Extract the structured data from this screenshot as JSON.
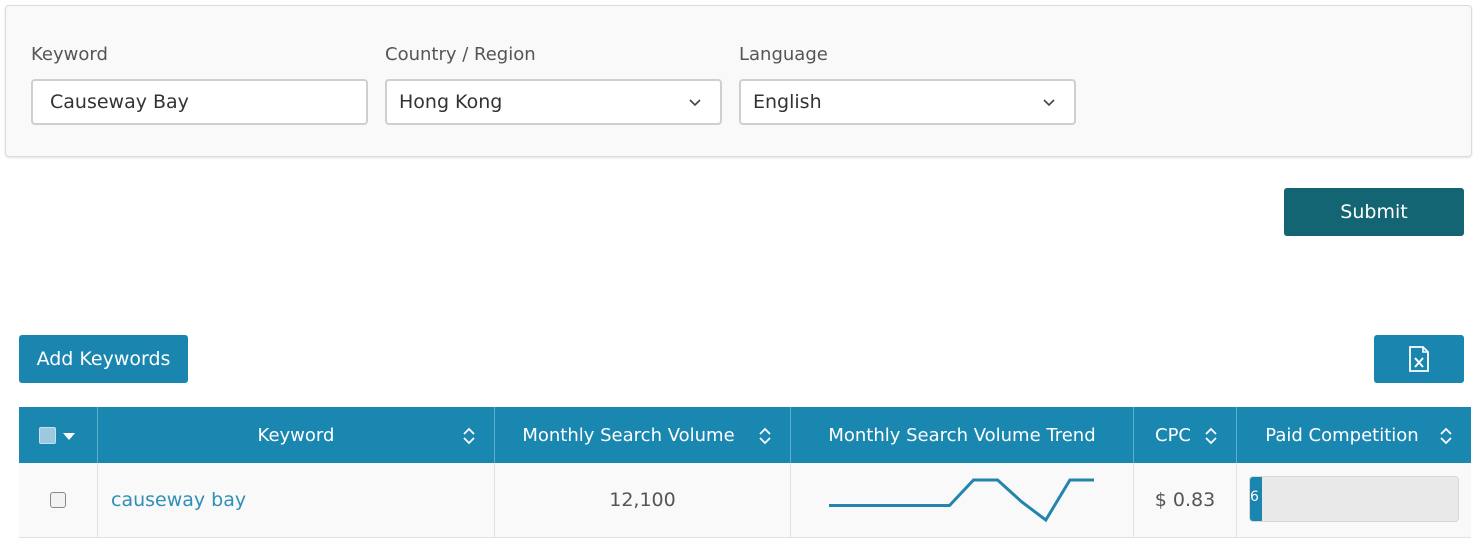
{
  "form": {
    "keyword_label": "Keyword",
    "keyword_value": "Causeway Bay",
    "country_label": "Country / Region",
    "country_value": "Hong Kong",
    "language_label": "Language",
    "language_value": "English"
  },
  "buttons": {
    "submit": "Submit",
    "add_keywords": "Add Keywords",
    "export_icon": "excel-file-icon"
  },
  "table": {
    "headers": {
      "keyword": "Keyword",
      "monthly_volume": "Monthly Search Volume",
      "trend": "Monthly Search Volume Trend",
      "cpc": "CPC",
      "paid_competition": "Paid Competition"
    },
    "rows": [
      {
        "keyword": "causeway bay",
        "monthly_volume": "12,100",
        "trend": [
          50,
          50,
          50,
          50,
          50,
          50,
          57,
          57,
          51,
          46,
          57,
          57
        ],
        "cpc": "$ 0.83",
        "paid_competition_text": "6",
        "paid_competition_level": 0.06
      }
    ]
  },
  "colors": {
    "primary": "#1a86b0",
    "submit": "#136573",
    "link": "#2e8fb8"
  }
}
